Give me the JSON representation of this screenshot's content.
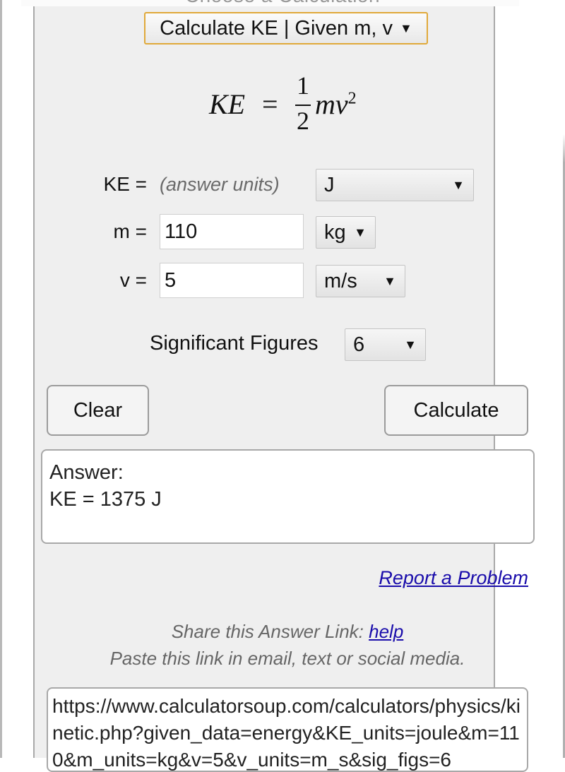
{
  "header": {
    "heading": "Choose a Calculation",
    "calculation_select": {
      "value": "Calculate KE | Given m, v",
      "arrow_icon": "triangle-down"
    }
  },
  "formula": {
    "lhs": "KE",
    "equals": "=",
    "numerator": "1",
    "denominator": "2",
    "rhs": "mv",
    "exponent": "2"
  },
  "fields": {
    "ke": {
      "label": "KE =",
      "hint": "(answer units)",
      "unit": "J"
    },
    "m": {
      "label": "m =",
      "value": "110",
      "unit": "kg"
    },
    "v": {
      "label": "v =",
      "value": "5",
      "unit": "m/s"
    }
  },
  "sig_figs": {
    "label": "Significant Figures",
    "value": "6"
  },
  "buttons": {
    "clear": "Clear",
    "calculate": "Calculate"
  },
  "answer": {
    "heading": "Answer:",
    "result": "KE = 1375 J"
  },
  "links": {
    "report": "Report a Problem",
    "share_prefix": "Share this Answer Link:",
    "share_help": "help",
    "share_instructions": "Paste this link in email, text or social media."
  },
  "share_url": "https://www.calculatorsoup.com/calculators/physics/kinetic.php?given_data=energy&KE_units=joule&m=110&m_units=kg&v=5&v_units=m_s&sig_figs=6"
}
